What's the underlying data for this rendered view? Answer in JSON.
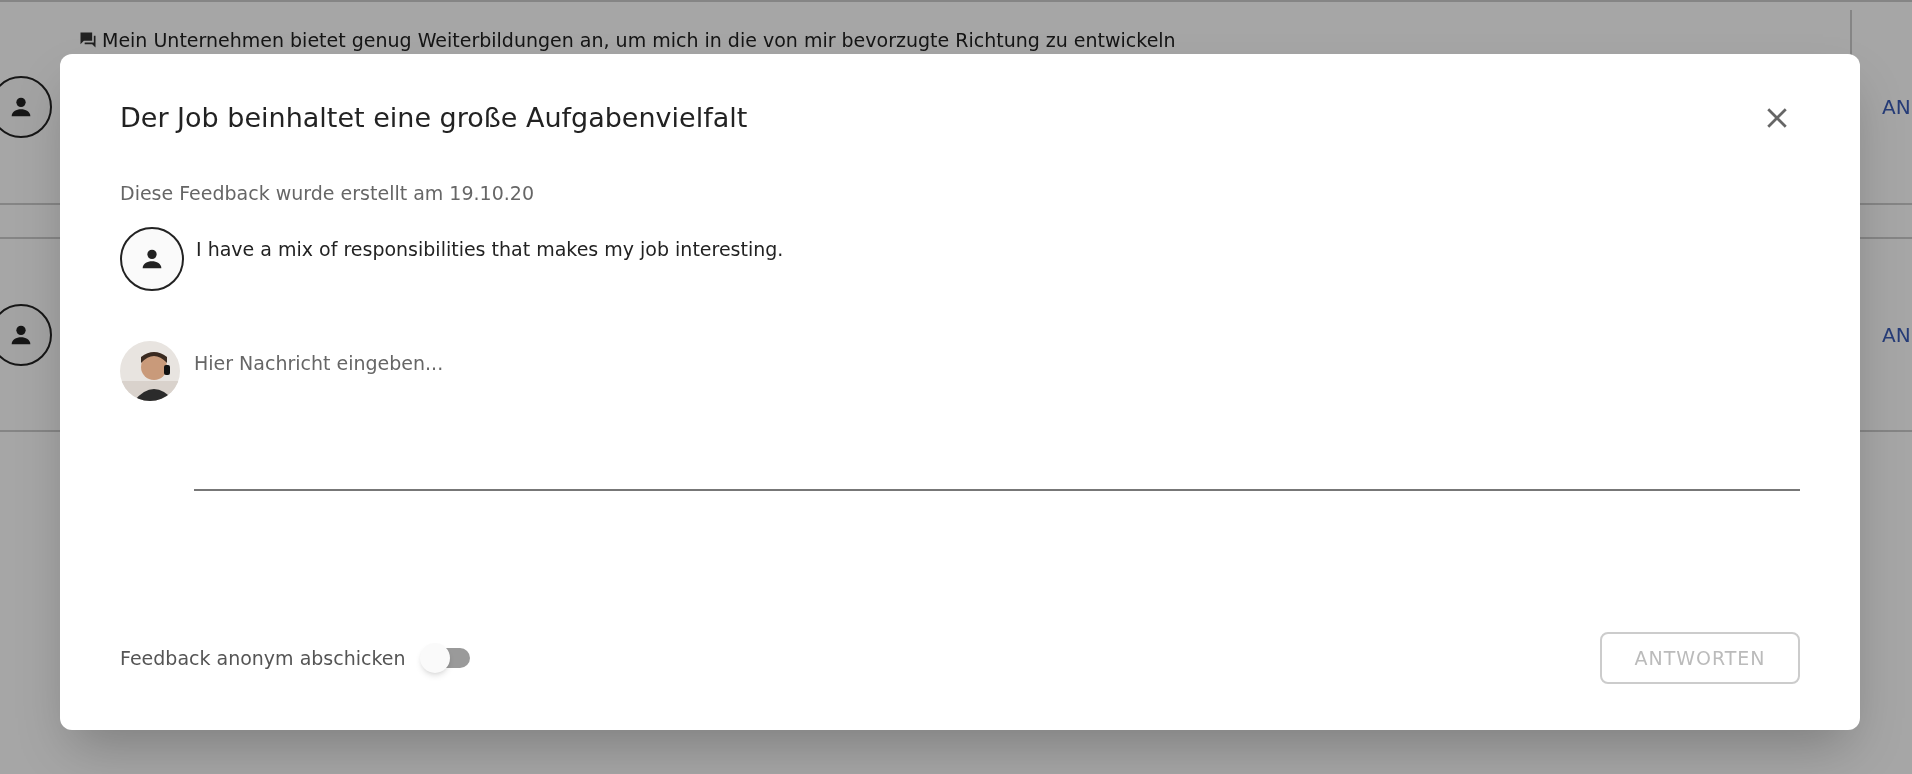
{
  "background": {
    "rows": [
      {
        "text": "Mein Unternehmen bietet genug Weiterbildungen an, um mich in die von mir bevorzugte Richtung zu entwickeln",
        "link": "AN"
      },
      {
        "link": "AN"
      }
    ]
  },
  "dialog": {
    "title": "Der Job beinhaltet eine große Aufgabenvielfalt",
    "subtitle": "Diese Feedback wurde erstellt am 19.10.20",
    "message": "I have a mix of responsibilities that makes my job interesting.",
    "reply": {
      "placeholder": "Hier Nachricht eingeben..."
    },
    "anonymous": {
      "label": "Feedback anonym abschicken",
      "on": false
    },
    "submit": {
      "label": "ANTWORTEN",
      "disabled": true
    }
  }
}
